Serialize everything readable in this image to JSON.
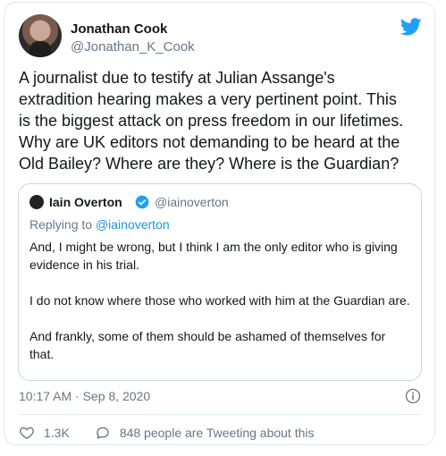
{
  "author": {
    "name": "Jonathan Cook",
    "handle": "@Jonathan_K_Cook"
  },
  "tweet_text": "A journalist due to testify at Julian Assange's\nextradition hearing makes a very pertinent point. This\nis the biggest attack on press freedom in our lifetimes.\nWhy are UK editors not demanding to be heard at the\nOld Bailey? Where are they? Where is the Guardian?",
  "quoted": {
    "name": "Iain Overton",
    "handle": "@iainoverton",
    "replying_prefix": "Replying to ",
    "replying_to": "@iainoverton",
    "paragraphs": [
      "And, I might be wrong, but I think I am the only editor who is giving evidence in his trial.",
      "I do not know where those who worked with him at the Guardian are.",
      "And frankly, some of them should be ashamed of themselves for that."
    ]
  },
  "timestamp": "10:17 AM · Sep 8, 2020",
  "likes": "1.3K",
  "tweeting_about": "848 people are Tweeting about this",
  "icons": {
    "brand": "twitter-bird-icon",
    "verified": "verified-badge-icon",
    "info": "info-icon",
    "like": "heart-icon",
    "conversation": "speech-bubble-icon"
  },
  "colors": {
    "brand_blue": "#1da1f2",
    "link_blue": "#1b95e0",
    "secondary_text": "#657786"
  }
}
